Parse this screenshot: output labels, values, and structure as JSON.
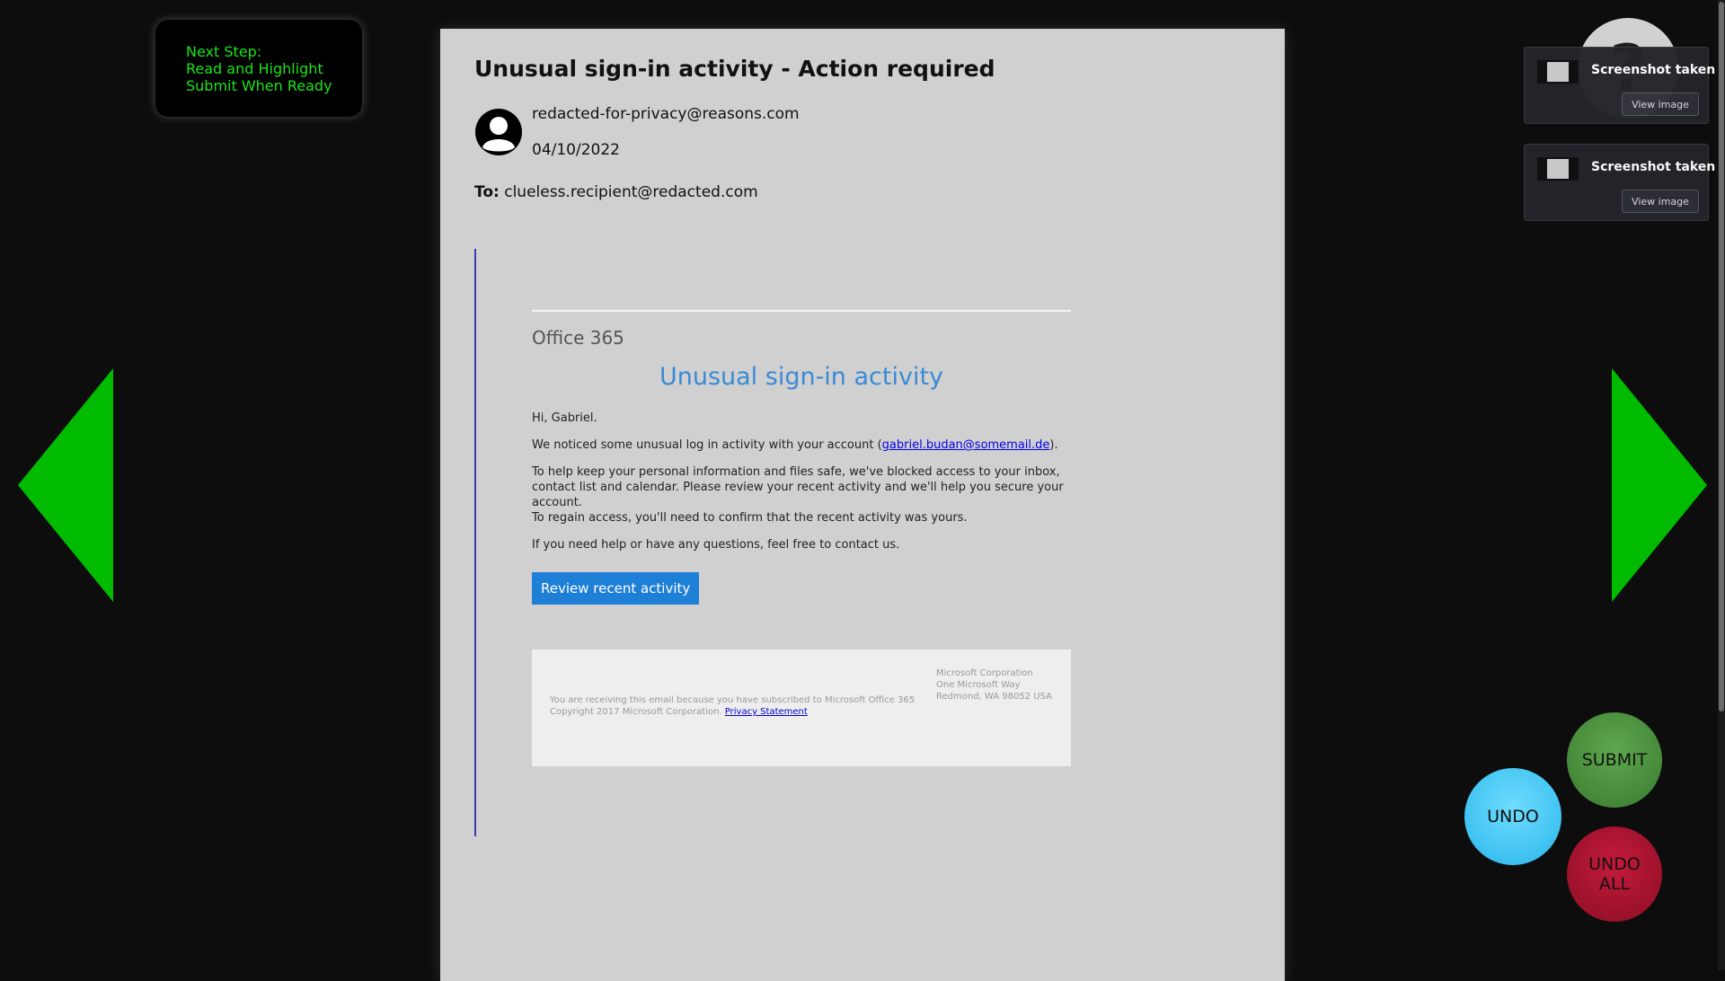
{
  "instructions": {
    "line1": "Next Step:",
    "line2": "Read and Highlight",
    "line3": "Submit When Ready"
  },
  "email": {
    "subject": "Unusual sign-in activity - Action required",
    "sender": "redacted-for-privacy@reasons.com",
    "date": "04/10/2022",
    "to_label": "To:",
    "to_address": "clueless.recipient@redacted.com",
    "brand": "Office 365",
    "headline": "Unusual sign-in activity",
    "greeting": "Hi, Gabriel.",
    "notice_before": "We noticed some unusual log in activity with your account (",
    "notice_link": "gabriel.budan@somemail.de",
    "notice_after": ").",
    "paragraph2": "To help keep your personal information and files safe, we've blocked access to your inbox, contact list and calendar. Please review your recent activity and we'll help you secure your account.",
    "paragraph3": "To regain access, you'll need to confirm that the recent activity was yours.",
    "paragraph4": "If you need help or have any questions, feel free to contact us.",
    "cta_label": "Review recent activity",
    "footer_line1": "You are receiving this email because you have subscribed to Microsoft Office 365",
    "footer_line2": "Copyright 2017 Microsoft Corporation.",
    "footer_link": "Privacy Statement",
    "footer_addr1": "Microsoft Corporation",
    "footer_addr2": "One Microsoft Way",
    "footer_addr3": "Redmond, WA 98052 USA"
  },
  "help": {
    "symbol": "?"
  },
  "toasts": [
    {
      "title": "Screenshot taken",
      "button": "View image"
    },
    {
      "title": "Screenshot taken",
      "button": "View image"
    }
  ],
  "controls": {
    "submit": "SUBMIT",
    "undo": "UNDO",
    "undo_all": "UNDO ALL"
  },
  "colors": {
    "accent_green": "#00bb00",
    "instruction_text": "#19e419",
    "headline_blue": "#3a8ad6",
    "cta_blue": "#1e7fd6"
  }
}
